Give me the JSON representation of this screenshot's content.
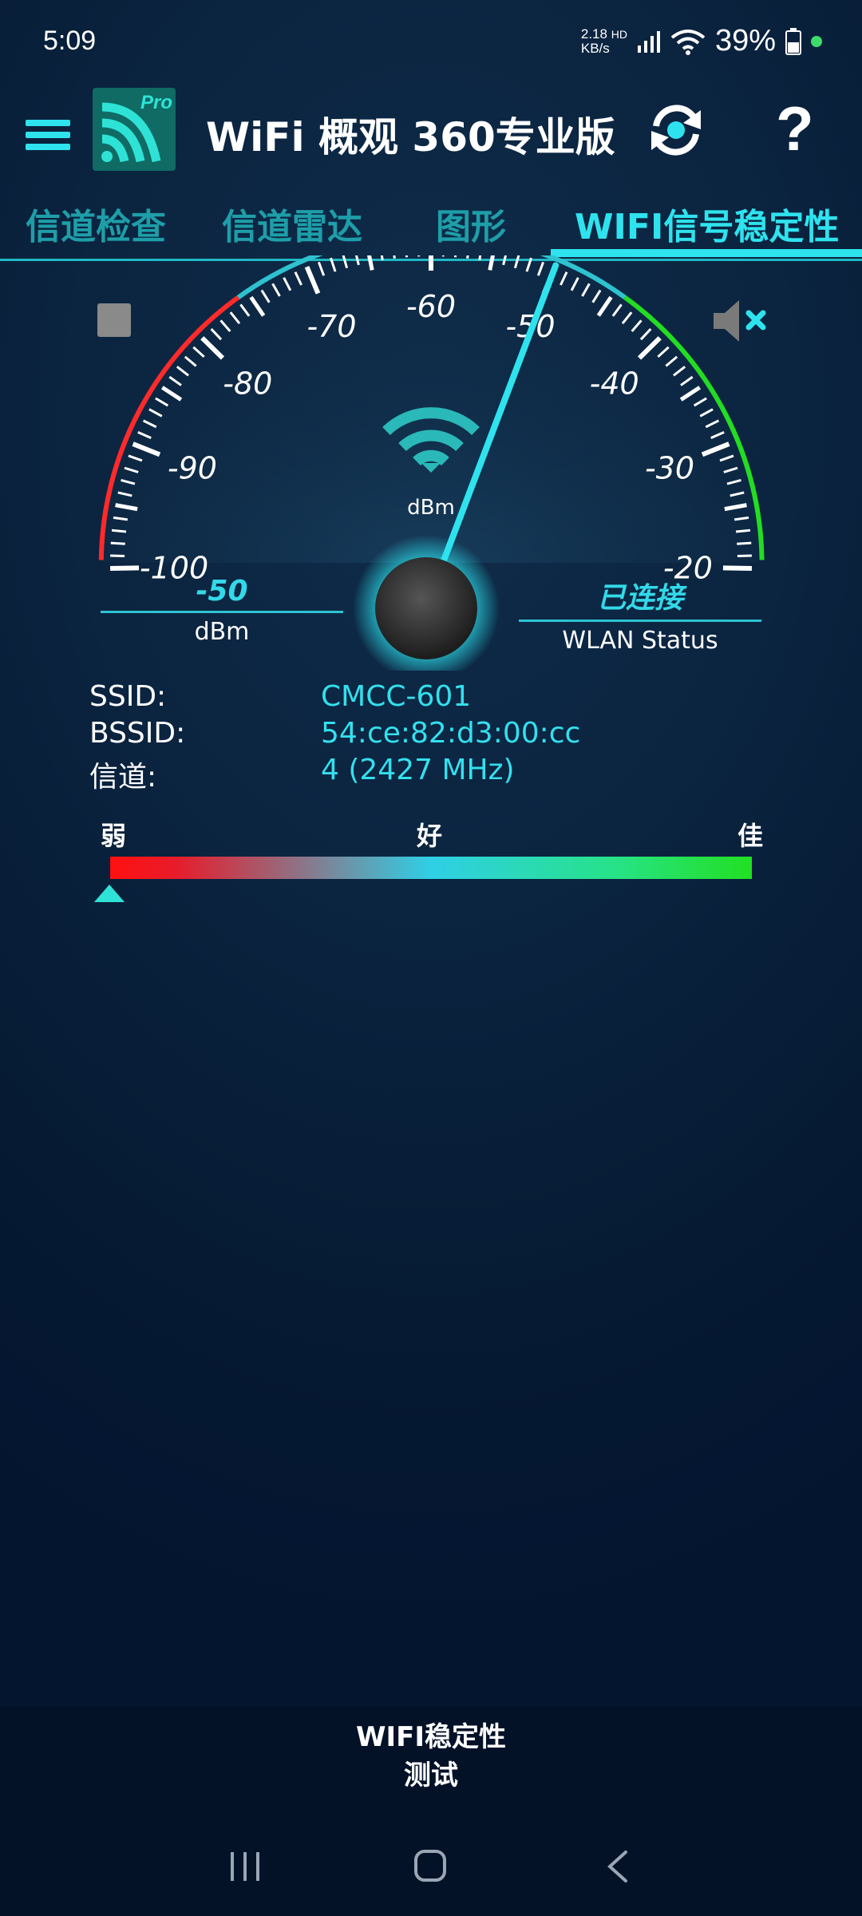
{
  "status_bar": {
    "time": "5:09",
    "net_speed_value": "2.18",
    "net_speed_unit": "KB/s",
    "network_type": "HD",
    "battery": "39%"
  },
  "app_bar": {
    "title": "WiFi 概观 360专业版",
    "logo_badge": "Pro"
  },
  "tabs": [
    {
      "label": "信道检查"
    },
    {
      "label": "信道雷达"
    },
    {
      "label": "图形"
    },
    {
      "label": "WIFI信号稳定性",
      "active": true
    }
  ],
  "gauge": {
    "ticks": [
      "-100",
      "-90",
      "-80",
      "-70",
      "-60",
      "-50",
      "-40",
      "-30",
      "-20"
    ],
    "center_unit": "dBm",
    "needle_value": -50,
    "min": -100,
    "max": -20
  },
  "readouts": {
    "signal_value": "-50",
    "signal_unit": "dBm",
    "status_value": "已连接",
    "status_label": "WLAN Status"
  },
  "info": {
    "ssid_label": "SSID:",
    "ssid_value": "CMCC-601",
    "bssid_label": "BSSID:",
    "bssid_value": "54:ce:82:d3:00:cc",
    "channel_label": "信道:",
    "channel_value": "4 (2427 MHz)"
  },
  "quality_scale": {
    "weak": "弱",
    "good": "好",
    "best": "佳"
  },
  "bottom": {
    "test_button_line1": "WIFI稳定性",
    "test_button_line2": "测试"
  },
  "colors": {
    "accent": "#2ee3ee",
    "tab_inactive": "#1e9ea8",
    "gauge_red": "#ff2a2a",
    "gauge_green": "#22dd22"
  }
}
